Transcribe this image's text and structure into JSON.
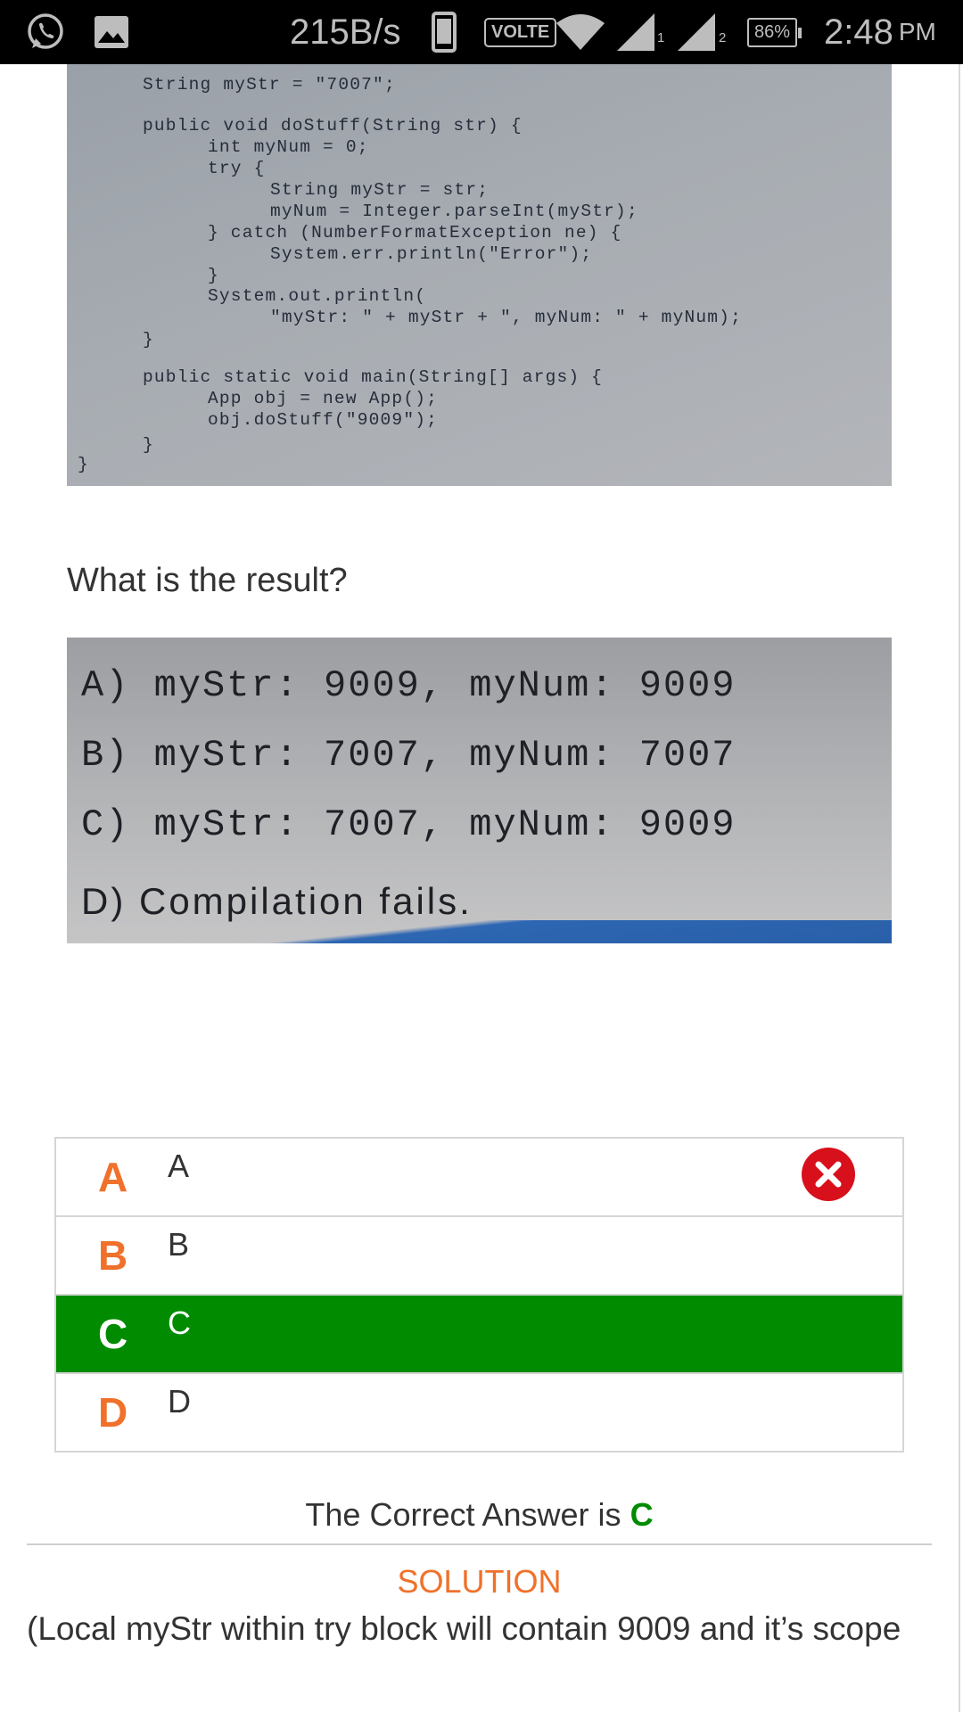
{
  "status_bar": {
    "speed": "215B/s",
    "network_badge": "VOLTE",
    "sim1": "1",
    "sim2": "2",
    "battery": "86%",
    "time": "2:48",
    "ampm": "PM",
    "icons": [
      "whatsapp-icon",
      "gallery-icon",
      "phone-icon",
      "wifi-icon",
      "signal-icon",
      "signal-icon"
    ]
  },
  "code_image": {
    "lines": [
      "String myStr = \"7007\";",
      "public void doStuff(String str) {",
      "int myNum = 0;",
      "try {",
      "String myStr = str;",
      "myNum = Integer.parseInt(myStr);",
      "} catch (NumberFormatException ne) {",
      "System.err.println(\"Error\");",
      "}",
      "System.out.println(",
      "\"myStr: \" + myStr + \", myNum: \" + myNum);",
      "}",
      "public static void main(String[] args) {",
      "App obj = new App();",
      "obj.doStuff(\"9009\");",
      "}",
      "}"
    ]
  },
  "question": "What is the result?",
  "options_image": {
    "lines": [
      "A) myStr: 9009, myNum: 9009",
      "B) myStr: 7007, myNum: 7007",
      "C) myStr: 7007, myNum: 9009",
      "D) Compilation fails."
    ]
  },
  "answers": [
    {
      "letter": "A",
      "text": "A",
      "state": "wrong"
    },
    {
      "letter": "B",
      "text": "B",
      "state": "none"
    },
    {
      "letter": "C",
      "text": "C",
      "state": "correct"
    },
    {
      "letter": "D",
      "text": "D",
      "state": "none"
    }
  ],
  "correct_answer": {
    "prefix": "The Correct Answer is",
    "letter": "C"
  },
  "solution": {
    "title": "SOLUTION",
    "text": "(Local myStr within try block will contain 9009 and it’s scope"
  },
  "colors": {
    "accent_orange": "#f0712b",
    "correct_green": "#008b00",
    "wrong_red": "#d8101c"
  }
}
